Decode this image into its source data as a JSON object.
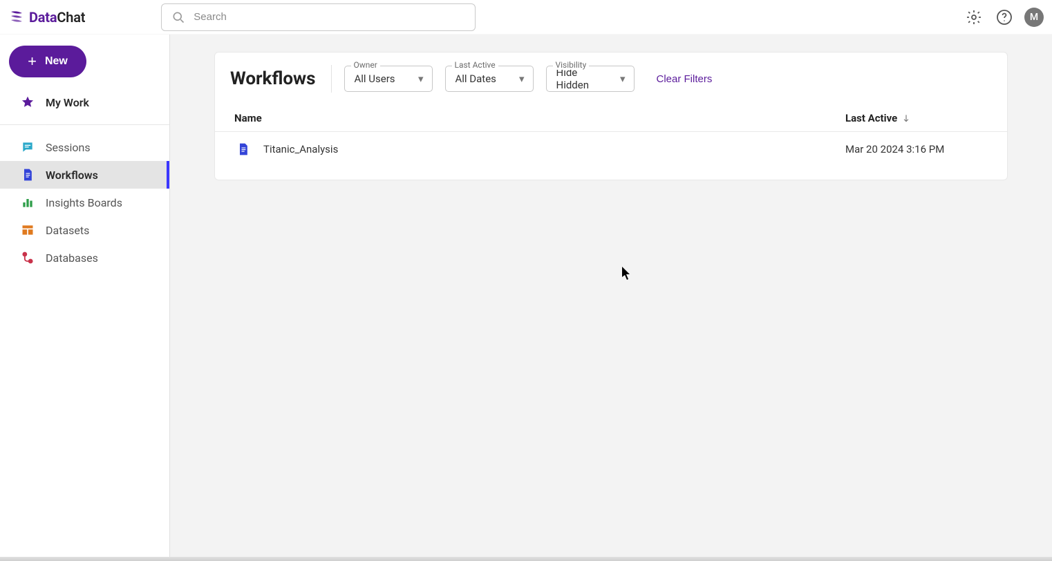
{
  "brand": {
    "name_a": "Data",
    "name_b": "Chat"
  },
  "search": {
    "placeholder": "Search"
  },
  "avatar_initial": "M",
  "sidebar": {
    "new_label": "New",
    "my_work_label": "My Work",
    "items": [
      {
        "label": "Sessions",
        "icon": "chat-icon",
        "color": "#2aa8c9"
      },
      {
        "label": "Workflows",
        "icon": "doc-icon",
        "color": "#3344d8",
        "active": true
      },
      {
        "label": "Insights Boards",
        "icon": "bar-chart-icon",
        "color": "#2e9e4a"
      },
      {
        "label": "Datasets",
        "icon": "table-icon",
        "color": "#e07a1f"
      },
      {
        "label": "Databases",
        "icon": "connection-icon",
        "color": "#c9334b"
      }
    ]
  },
  "page": {
    "title": "Workflows",
    "filters": {
      "owner": {
        "label": "Owner",
        "value": "All Users"
      },
      "last_active": {
        "label": "Last Active",
        "value": "All Dates"
      },
      "visibility": {
        "label": "Visibility",
        "value": "Hide Hidden"
      }
    },
    "clear_filters_label": "Clear Filters",
    "columns": {
      "name": "Name",
      "last_active": "Last Active"
    },
    "rows": [
      {
        "name": "Titanic_Analysis",
        "last_active": "Mar 20 2024 3:16 PM"
      }
    ]
  }
}
